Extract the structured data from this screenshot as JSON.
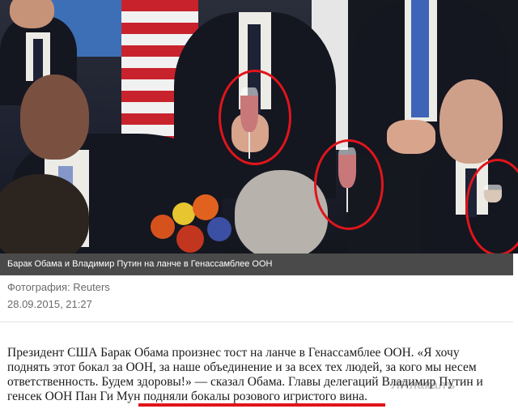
{
  "photo": {
    "alt": "Барак Обама и Владимир Путин на ланче в Генассамблее ООН"
  },
  "caption": {
    "text": "Барак Обама и Владимир Путин на ланче в Генассамблее ООН"
  },
  "meta": {
    "source": "Фотография: Reuters",
    "date": "28.09.2015, 21:27"
  },
  "article": {
    "lines": [
      "Президент США Барак Обама произнес тост на ланче в Генассамблее ООН. «Я хочу",
      "поднять этот бокал за ООН, за наше объединение и за всех тех людей, за кого мы несем",
      "ответственность. Будем здоровы!» — сказал Обама. Главы делегаций Владимир Путин и",
      "генсек ООН Пан Ги Мун подняли бокалы розового игристого вина."
    ]
  },
  "watermark": {
    "text": "ЯПлакалъ"
  },
  "colors": {
    "highlight": "#e0151b",
    "caption_bg": "#4a4a4a"
  }
}
